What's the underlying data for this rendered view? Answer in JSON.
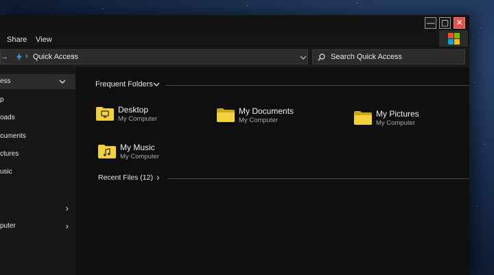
{
  "window": {
    "controls": {
      "minimize": "—",
      "maximize": "▢",
      "close": "✕"
    },
    "brand_icon": "windows-logo-icon"
  },
  "ribbon": {
    "tabs": [
      "Share",
      "View"
    ]
  },
  "address_bar": {
    "location_icon": "quick-access-bolt-icon",
    "path": "Quick Access"
  },
  "search": {
    "placeholder": "Search Quick Access"
  },
  "sidebar": {
    "items": [
      {
        "label": "ess",
        "selected": true,
        "expander": "chevron-down"
      },
      {
        "label": "p"
      },
      {
        "label": "oads"
      },
      {
        "label": "cuments"
      },
      {
        "label": "ctures"
      },
      {
        "label": "usic"
      },
      {
        "label": "",
        "expander": "chevron-right"
      },
      {
        "label": "puter",
        "expander": "chevron-right"
      }
    ]
  },
  "frequent_folders": {
    "header": "Frequent Folders",
    "folders": [
      {
        "name": "Desktop",
        "location": "My Computer",
        "icon": "desktop-folder-icon"
      },
      {
        "name": "My Documents",
        "location": "My Computer",
        "icon": "folder-icon"
      },
      {
        "name": "My Pictures",
        "location": "My Computer",
        "icon": "folder-icon"
      },
      {
        "name": "My Music",
        "location": "My Computer",
        "icon": "music-folder-icon"
      }
    ]
  },
  "recent_files": {
    "header": "Recent Files (12)"
  },
  "colors": {
    "folder_yellow": "#f2d13b",
    "folder_dark": "#c9a820",
    "close_red": "#e0524a"
  }
}
